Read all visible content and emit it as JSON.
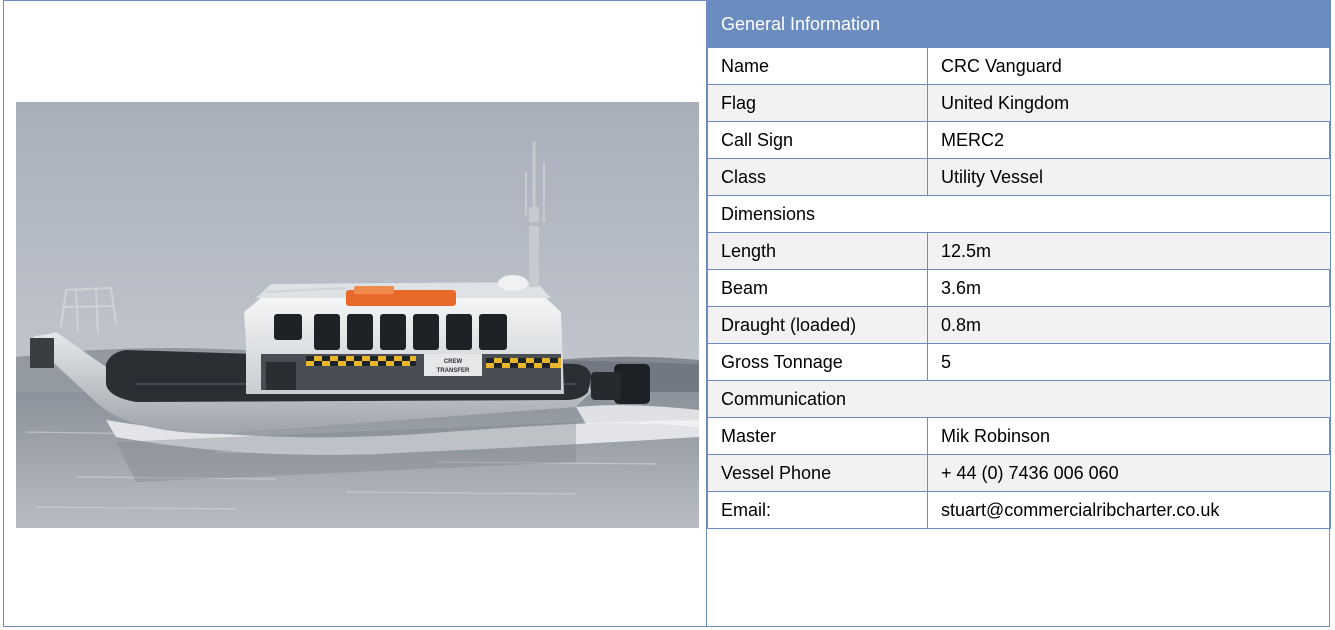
{
  "table": {
    "header": "General Information",
    "rows": [
      {
        "label": "Name",
        "value": "CRC Vanguard"
      },
      {
        "label": "Flag",
        "value": "United Kingdom"
      },
      {
        "label": "Call Sign",
        "value": "MERC2"
      },
      {
        "label": "Class",
        "value": "Utility Vessel"
      }
    ],
    "section_dimensions": "Dimensions",
    "dimensions": [
      {
        "label": "Length",
        "value": "12.5m"
      },
      {
        "label": "Beam",
        "value": "3.6m"
      },
      {
        "label": "Draught (loaded)",
        "value": "0.8m"
      },
      {
        "label": "Gross Tonnage",
        "value": "5"
      }
    ],
    "section_communication": "Communication",
    "communication": [
      {
        "label": "Master",
        "value": "Mik Robinson"
      },
      {
        "label": "Vessel Phone",
        "value": "+ 44 (0) 7436 006 060"
      },
      {
        "label": "Email:",
        "value": "stuart@commercialribcharter.co.uk"
      }
    ]
  },
  "photo": {
    "boat_label_line1": "CREW",
    "boat_label_line2": "TRANSFER"
  },
  "colors": {
    "header_bg": "#6a8cbf",
    "border": "#6b8dc0",
    "shaded_row": "#f2f2f2"
  }
}
